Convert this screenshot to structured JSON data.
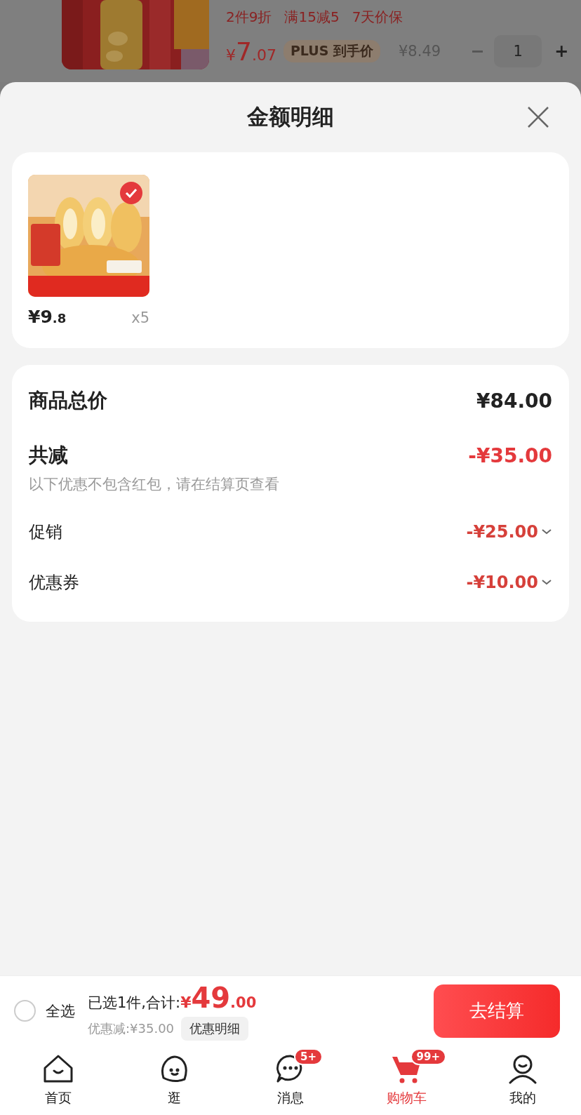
{
  "background_item": {
    "promo_tags": [
      "2件9折",
      "满15减5",
      "7天价保"
    ],
    "price_symbol": "¥",
    "price_int": "7",
    "price_dec": ".07",
    "plus_badge": "PLUS 到手价",
    "original_price": "¥8.49",
    "minus": "−",
    "quantity": "1",
    "plus": "+"
  },
  "sheet": {
    "title": "金额明细",
    "products": [
      {
        "kind": "picture",
        "selected": true,
        "price_symbol": "¥",
        "price_int": "9",
        "price_dec": ".8",
        "quantity": "x5"
      }
    ],
    "summary": {
      "total_label": "商品总价",
      "total_value": "¥84.00",
      "reduction_label": "共减",
      "reduction_value": "-¥35.00",
      "note": "以下优惠不包含红包，请在结算页查看",
      "details": [
        {
          "label": "促销",
          "value": "-¥25.00"
        },
        {
          "label": "优惠券",
          "value": "-¥10.00"
        }
      ]
    }
  },
  "checkout_bar": {
    "select_all": {
      "label": "全选",
      "checked": false
    },
    "selected_text": "已选1件,合计:",
    "total_symbol": "¥",
    "total_int": "49",
    "total_dec": ".00",
    "discount": "优惠减:¥35.00",
    "details_button": "优惠明细",
    "checkout_button": "去结算"
  },
  "tab_bar": [
    {
      "kind": "home",
      "label": "首页",
      "selected": false
    },
    {
      "kind": "browse",
      "label": "逛",
      "selected": false
    },
    {
      "kind": "message",
      "label": "消息",
      "badge": "5+",
      "selected": false
    },
    {
      "kind": "cart",
      "label": "购物车",
      "badge": "99+",
      "selected": true
    },
    {
      "kind": "profile",
      "label": "我的",
      "selected": false
    }
  ]
}
